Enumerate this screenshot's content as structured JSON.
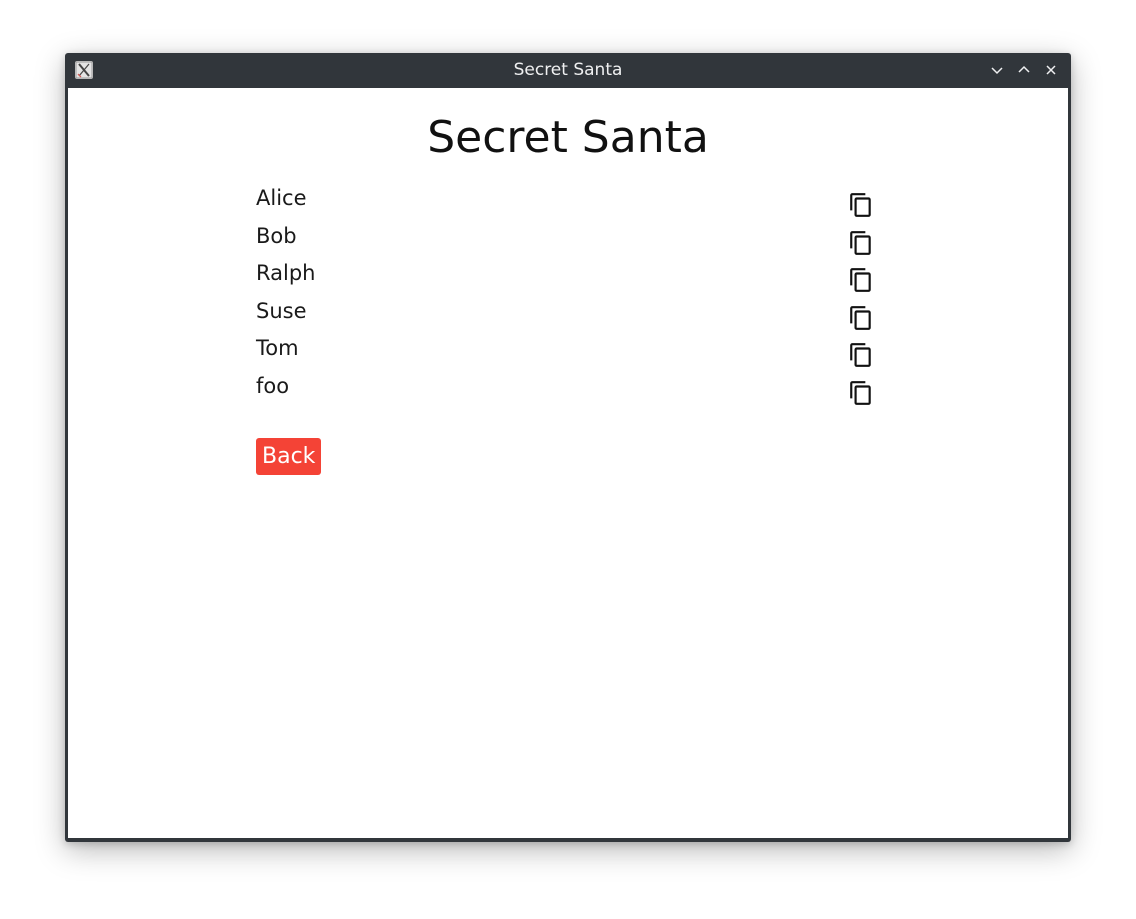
{
  "window": {
    "title": "Secret Santa"
  },
  "page": {
    "title": "Secret Santa"
  },
  "participants": [
    {
      "name": "Alice"
    },
    {
      "name": "Bob"
    },
    {
      "name": "Ralph"
    },
    {
      "name": "Suse"
    },
    {
      "name": "Tom"
    },
    {
      "name": "foo"
    }
  ],
  "actions": {
    "back_label": "Back"
  },
  "icons": {
    "row_action": "copy-icon",
    "app": "x11-app-icon",
    "minimize": "chevron-down-icon",
    "maximize": "chevron-up-icon",
    "close": "close-icon"
  },
  "colors": {
    "titlebar": "#31363b",
    "back_button": "#f44336"
  }
}
